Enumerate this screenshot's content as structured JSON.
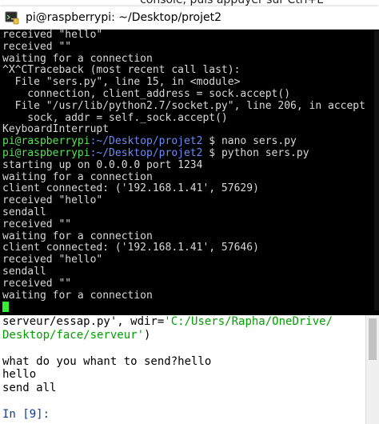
{
  "background_window": {
    "cut_text": "console, puis appuyer sur Ctrl+L"
  },
  "terminal": {
    "title": "pi@raspberrypi: ~/Desktop/projet2",
    "lines": [
      {
        "text": "received \"hello\""
      },
      {
        "text": "received \"\""
      },
      {
        "text": "waiting for a connection"
      },
      {
        "text": "^X^CTraceback (most recent call last):"
      },
      {
        "text": "  File \"sers.py\", line 15, in <module>"
      },
      {
        "text": "    connection, client_address = sock.accept()"
      },
      {
        "text": "  File \"/usr/lib/python2.7/socket.py\", line 206, in accept"
      },
      {
        "text": "    sock, addr = self._sock.accept()"
      },
      {
        "text": "KeyboardInterrupt"
      },
      {
        "user": "pi@raspberrypi",
        "path": ":~/Desktop/projet2",
        "cmd": " $ nano sers.py"
      },
      {
        "user": "pi@raspberrypi",
        "path": ":~/Desktop/projet2",
        "cmd": " $ python sers.py"
      },
      {
        "text": "starting up on 0.0.0.0 port 1234"
      },
      {
        "text": "waiting for a connection"
      },
      {
        "text": "client connected: ('192.168.1.41', 57629)"
      },
      {
        "text": "received \"hello\""
      },
      {
        "text": "sendall"
      },
      {
        "text": "received \"\""
      },
      {
        "text": "waiting for a connection"
      },
      {
        "text": "client connected: ('192.168.1.41', 57646)"
      },
      {
        "text": "received \"hello\""
      },
      {
        "text": "sendall"
      },
      {
        "text": "received \"\""
      },
      {
        "text": "waiting for a connection"
      }
    ]
  },
  "console": {
    "run_line_1": {
      "before": "serveur/essap.py', wdir=",
      "string": "'C:/Users/Rapha/OneDrive/"
    },
    "run_line_2": {
      "string": "Desktop/face/serveur'",
      "after": ")"
    },
    "output": [
      "what do you whant to send?hello",
      "hello",
      "send all"
    ],
    "prompt": "In [9]:"
  },
  "colors": {
    "terminal_bg": "#000000",
    "prompt_user": "#55e655",
    "prompt_path": "#6b8cff",
    "cursor": "#33ee33",
    "console_string": "#00a000",
    "console_prompt": "#0a3c96"
  }
}
